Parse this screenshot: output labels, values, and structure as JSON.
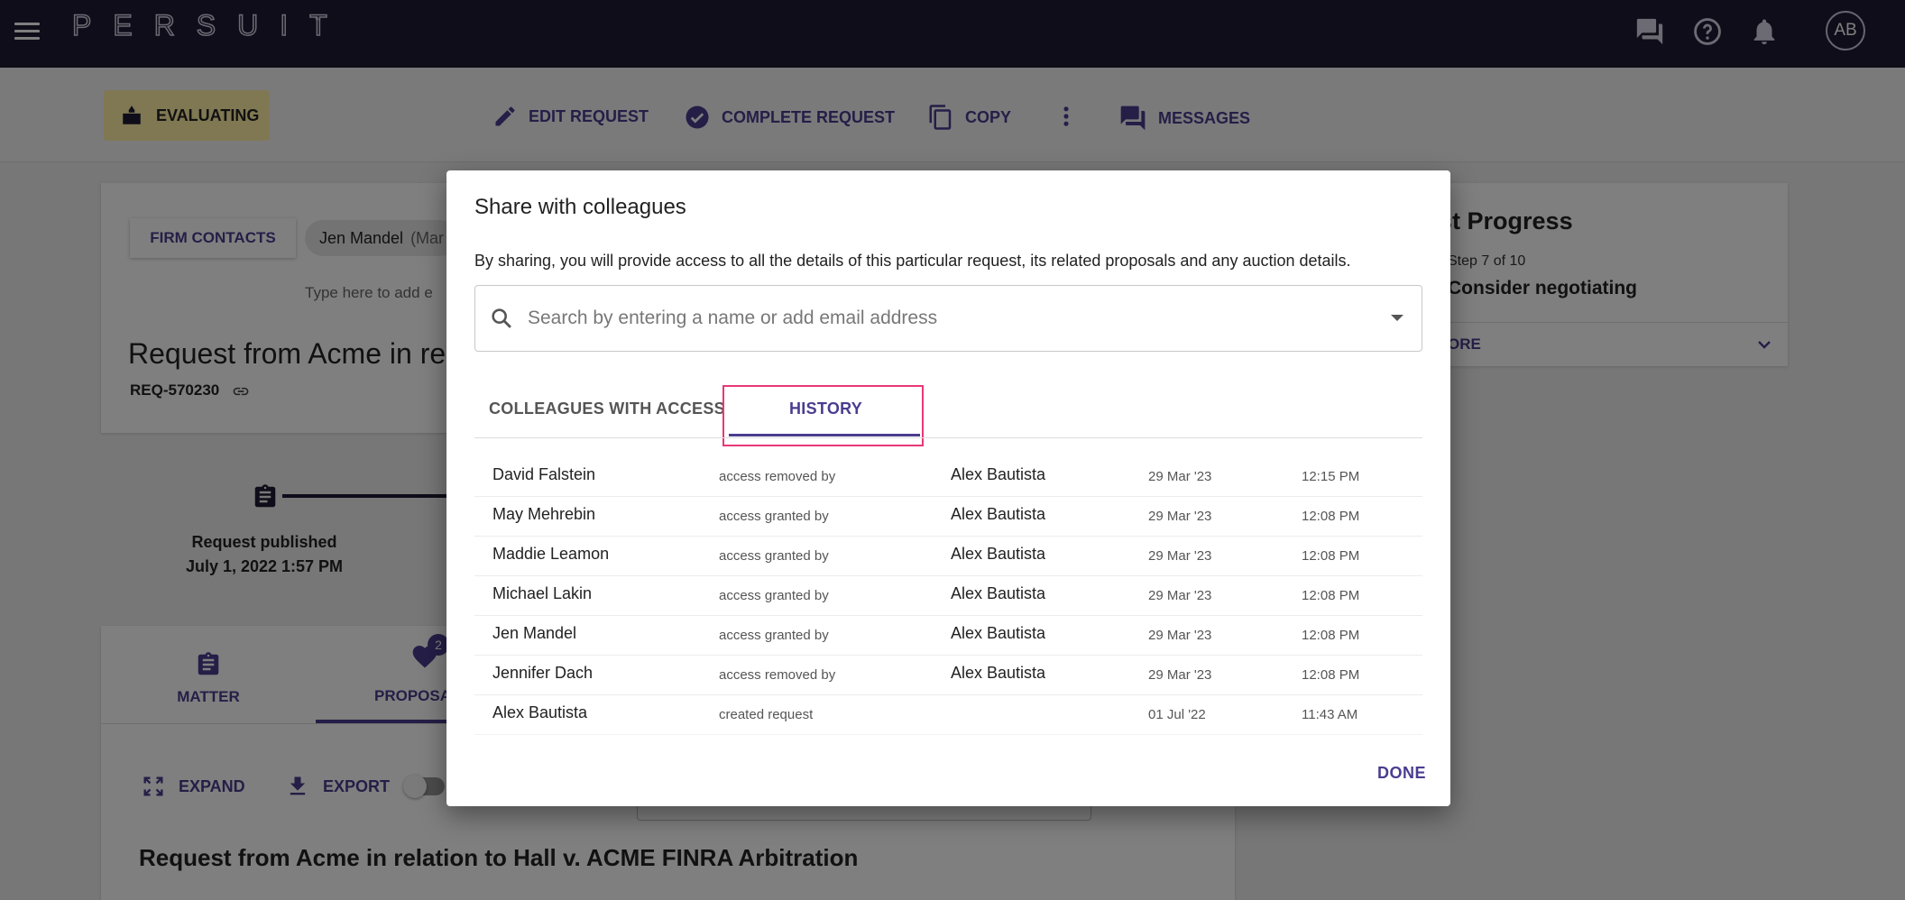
{
  "topbar": {
    "logo": "PERSUIT",
    "logo_tm": "™",
    "avatar_initials": "AB",
    "icons": [
      "menu-icon",
      "chat-icon",
      "help-icon",
      "bell-icon"
    ]
  },
  "actionbar": {
    "status": "EVALUATING",
    "edit_request": "EDIT REQUEST",
    "complete_request": "COMPLETE REQUEST",
    "copy": "COPY",
    "messages": "MESSAGES",
    "status_color": "#fff0a6",
    "accent_color": "#4a3d8f"
  },
  "background": {
    "firm_contacts": "FIRM CONTACTS",
    "contact_name": "Jen Mandel",
    "contact_note": "(Mar",
    "type_here": "Type here to add e",
    "request_title": "Request from Acme in rel",
    "request_id": "REQ-570230",
    "timeline_label": "Request published",
    "timeline_date": "July 1, 2022 1:57 PM",
    "tab_matter": "MATTER",
    "tab_proposals": "PROPOSA",
    "proposal_count": "2",
    "expand": "EXPAND",
    "export": "EXPORT",
    "bottom_title": "Request from Acme in relation to Hall v. ACME FINRA Arbitration",
    "progress_title": "est Progress",
    "progress_step": "Step 7 of 10",
    "progress_name": "Consider negotiating",
    "progress_more": "ORE"
  },
  "modal": {
    "title": "Share with colleagues",
    "description": "By sharing, you will provide access to all the details of this particular request, its related proposals and any auction details.",
    "search_placeholder": "Search by entering a name or add email address",
    "tabs": [
      {
        "label": "COLLEAGUES WITH ACCESS",
        "active": false
      },
      {
        "label": "HISTORY",
        "active": true
      }
    ],
    "history": [
      {
        "name": "David Falstein",
        "action": "access removed by",
        "by": "Alex Bautista",
        "date": "29 Mar '23",
        "time": "12:15 PM"
      },
      {
        "name": "May Mehrebin",
        "action": "access granted by",
        "by": "Alex Bautista",
        "date": "29 Mar '23",
        "time": "12:08 PM"
      },
      {
        "name": "Maddie Leamon",
        "action": "access granted by",
        "by": "Alex Bautista",
        "date": "29 Mar '23",
        "time": "12:08 PM"
      },
      {
        "name": "Michael Lakin",
        "action": "access granted by",
        "by": "Alex Bautista",
        "date": "29 Mar '23",
        "time": "12:08 PM"
      },
      {
        "name": "Jen Mandel",
        "action": "access granted by",
        "by": "Alex Bautista",
        "date": "29 Mar '23",
        "time": "12:08 PM"
      },
      {
        "name": "Jennifer Dach",
        "action": "access removed by",
        "by": "Alex Bautista",
        "date": "29 Mar '23",
        "time": "12:08 PM"
      },
      {
        "name": "Alex Bautista",
        "action": "created request",
        "by": "",
        "date": "01 Jul '22",
        "time": "11:43 AM"
      }
    ],
    "done": "DONE",
    "highlight_color": "#e8387a"
  }
}
